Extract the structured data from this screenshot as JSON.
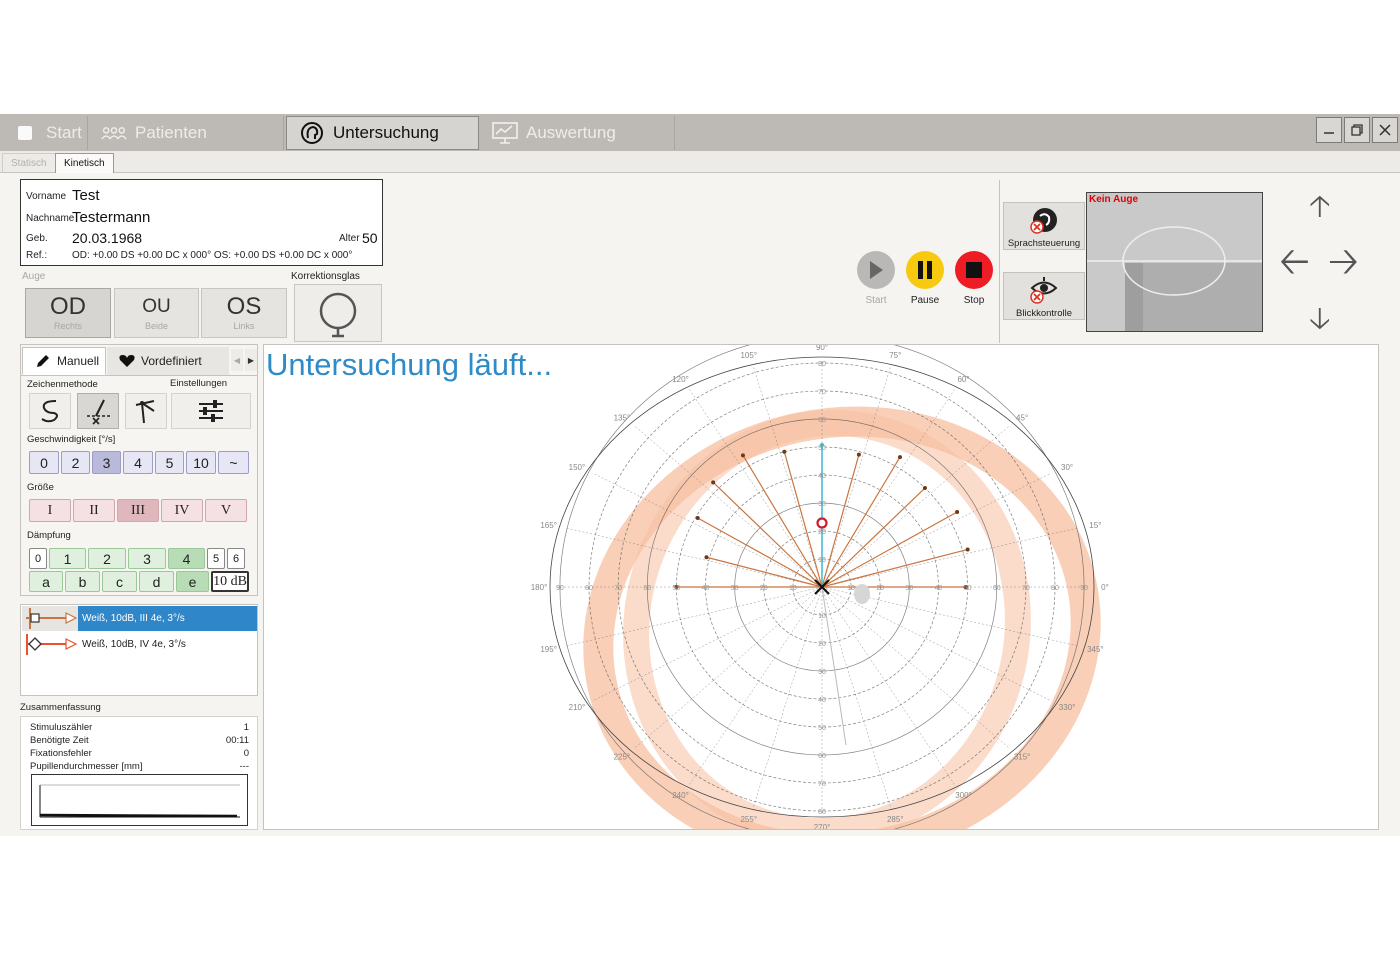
{
  "topbar": {
    "tabs": [
      {
        "label": "Start",
        "icon": "start-icon"
      },
      {
        "label": "Patienten",
        "icon": "patients-icon"
      },
      {
        "label": "Untersuchung",
        "icon": "exam-head-icon",
        "active": true
      },
      {
        "label": "Auswertung",
        "icon": "chart-board-icon"
      }
    ]
  },
  "subtabs": [
    "Statisch",
    "Kinetisch"
  ],
  "patient": {
    "vorname_label": "Vorname",
    "vorname": "Test",
    "nachname_label": "Nachname",
    "nachname": "Testermann",
    "geb_label": "Geb.",
    "geb": "20.03.1968",
    "alter_label": "Alter",
    "alter": "50",
    "ref_label": "Ref.:",
    "ref": "OD: +0.00 DS +0.00 DC x 000° OS: +0.00 DS +0.00 DC x 000°"
  },
  "eye": {
    "label": "Auge",
    "buttons": [
      {
        "big": "OD",
        "small": "Rechts"
      },
      {
        "big": "OU",
        "small": "Beide"
      },
      {
        "big": "OS",
        "small": "Links"
      }
    ],
    "correction_label": "Korrektionsglas"
  },
  "panel": {
    "tab_manual": "Manuell",
    "tab_predefined": "Vordefiniert",
    "draw_method_label": "Zeichenmethode",
    "settings_label": "Einstellungen",
    "speed_label": "Geschwindigkeit [°/s]",
    "speed": [
      "0",
      "2",
      "3",
      "4",
      "5",
      "10",
      "~"
    ],
    "size_label": "Größe",
    "size": [
      "I",
      "II",
      "III",
      "IV",
      "V"
    ],
    "damp_label": "Dämpfung",
    "damp_row1": [
      "0",
      "1",
      "2",
      "3",
      "4",
      "5",
      "6"
    ],
    "damp_row2": [
      "a",
      "b",
      "c",
      "d",
      "e"
    ],
    "damp_value": "10 dB"
  },
  "stimuli": [
    {
      "label": "Weiß, 10dB, III 4e, 3°/s",
      "color": "#c9753e"
    },
    {
      "label": "Weiß, 10dB, IV 4e, 3°/s",
      "color": "#e8542f"
    }
  ],
  "summary": {
    "title": "Zusammenfassung",
    "rows": [
      {
        "k": "Stimuluszähler",
        "v": "1"
      },
      {
        "k": "Benötigte Zeit",
        "v": "00:11"
      },
      {
        "k": "Fixationsfehler",
        "v": "0"
      },
      {
        "k": "Pupillendurchmesser [mm]",
        "v": "---"
      }
    ]
  },
  "status_text": "Untersuchung läuft...",
  "controls": {
    "start": "Start",
    "pause": "Pause",
    "stop": "Stop"
  },
  "side": {
    "voice": "Sprachsteuerung",
    "gaze": "Blickkontrolle"
  },
  "camera": {
    "label": "Kein Auge"
  },
  "chart": {
    "angle_labels": [
      "0°",
      "15°",
      "30°",
      "45°",
      "60°",
      "75°",
      "90°",
      "105°",
      "120°",
      "135°",
      "150°",
      "165°",
      "180°",
      "195°",
      "210°",
      "225°",
      "240°",
      "255°",
      "270°",
      "285°",
      "300°",
      "315°",
      "330°",
      "345°"
    ],
    "ring_labels": [
      "10",
      "20",
      "30",
      "40",
      "50",
      "60",
      "70",
      "80",
      "90"
    ],
    "colors": {
      "vector": "#c9753e",
      "isopter": "#f7bfa0",
      "active": "#39b9cf",
      "fixation": "#cc1f2b"
    }
  }
}
